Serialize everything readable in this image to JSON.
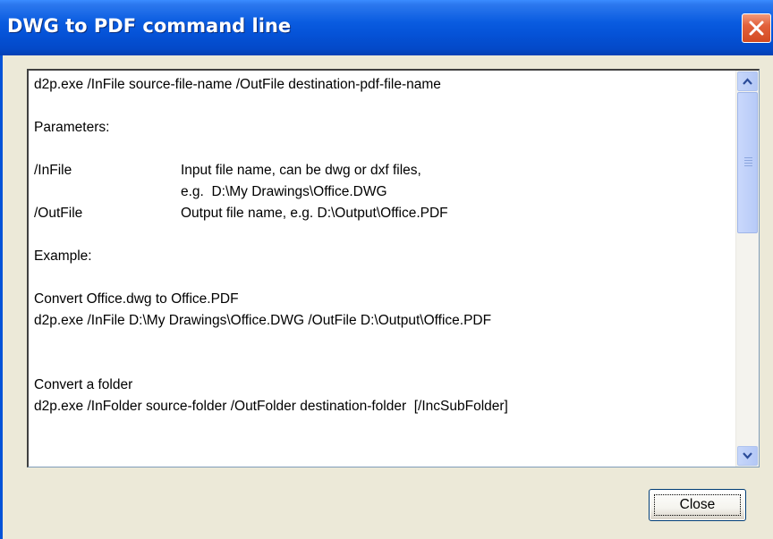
{
  "window": {
    "title": "DWG to PDF command line"
  },
  "help": {
    "usage": "d2p.exe /InFile source-file-name /OutFile destination-pdf-file-name",
    "parameters_heading": "Parameters:",
    "params": [
      {
        "name": "/InFile",
        "desc": "Input file name, can be dwg or dxf files,",
        "desc2": "e.g.  D:\\My Drawings\\Office.DWG"
      },
      {
        "name": "/OutFile",
        "desc": "Output file name, e.g. D:\\Output\\Office.PDF"
      }
    ],
    "example_heading": "Example:",
    "example1_title": "Convert Office.dwg to Office.PDF",
    "example1_cmd": "d2p.exe /InFile D:\\My Drawings\\Office.DWG /OutFile D:\\Output\\Office.PDF",
    "example2_title": "Convert a folder",
    "example2_cmd": "d2p.exe /InFolder source-folder /OutFolder destination-folder  [/IncSubFolder]"
  },
  "buttons": {
    "close_label": "Close"
  },
  "icons": {
    "title_close": "close-x-icon",
    "scroll_up": "arrow-up-icon",
    "scroll_down": "arrow-down-icon"
  },
  "colors": {
    "titlebar": "#0553D8",
    "dialog_bg": "#ECE9D8",
    "close_red": "#D34A22"
  }
}
